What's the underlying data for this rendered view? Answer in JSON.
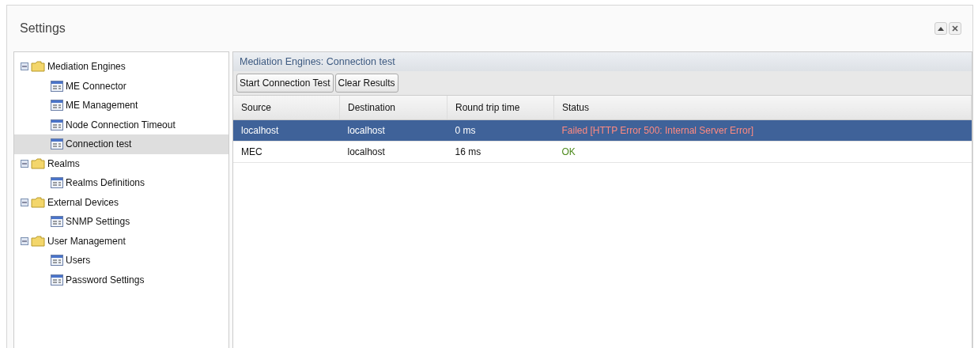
{
  "window": {
    "title": "Settings",
    "buttons": [
      {
        "kind": "collapse"
      },
      {
        "kind": "close"
      }
    ]
  },
  "tree": [
    {
      "label": "Mediation Engines",
      "expanded": true,
      "selected": false,
      "children": [
        {
          "label": "ME Connector",
          "selected": false
        },
        {
          "label": "ME Management",
          "selected": false
        },
        {
          "label": "Node Connection Timeout",
          "selected": false
        },
        {
          "label": "Connection test",
          "selected": true
        }
      ]
    },
    {
      "label": "Realms",
      "expanded": true,
      "selected": false,
      "children": [
        {
          "label": "Realms Definitions",
          "selected": false
        }
      ]
    },
    {
      "label": "External Devices",
      "expanded": true,
      "selected": false,
      "children": [
        {
          "label": "SNMP Settings",
          "selected": false
        }
      ]
    },
    {
      "label": "User Management",
      "expanded": true,
      "selected": false,
      "children": [
        {
          "label": "Users",
          "selected": false
        },
        {
          "label": "Password Settings",
          "selected": false
        }
      ]
    }
  ],
  "panel": {
    "title": "Mediation Engines: Connection test",
    "buttons": [
      "Start Connection Test",
      "Clear Results"
    ],
    "table": {
      "columns": [
        "Source",
        "Destination",
        "Round trip time",
        "Status"
      ],
      "rows": [
        {
          "source": "localhost",
          "destination": "localhost",
          "time": "0 ms",
          "status": "Failed [HTTP Error 500: Internal Server Error]",
          "color": "#ff8a80",
          "selected": true
        },
        {
          "source": "MEC",
          "destination": "localhost",
          "time": "16 ms",
          "status": "OK",
          "color": "#4d8a1d",
          "selected": false
        }
      ]
    }
  }
}
